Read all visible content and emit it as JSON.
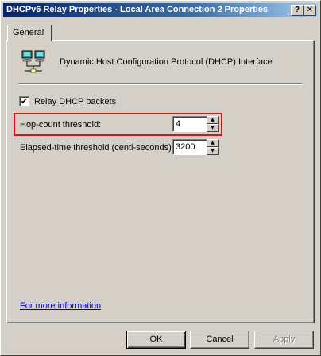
{
  "window": {
    "title": "DHCPv6 Relay Properties - Local Area Connection 2 Properties",
    "help_button": "?",
    "close_button": "✕"
  },
  "tabs": [
    {
      "label": "General",
      "selected": true
    }
  ],
  "general": {
    "icon": "network-computers-icon",
    "interface_label": "Dynamic Host Configuration Protocol (DHCP) Interface",
    "relay_checkbox": {
      "label": "Relay DHCP packets",
      "checked": true,
      "mark": "✔"
    },
    "hop_count": {
      "label": "Hop-count threshold:",
      "value": "4"
    },
    "elapsed_time": {
      "label": "Elapsed-time threshold (centi-seconds):",
      "value": "3200"
    },
    "spin_up": "▲",
    "spin_down": "▼",
    "more_info_link": "For more information"
  },
  "buttons": {
    "ok": "OK",
    "cancel": "Cancel",
    "apply": "Apply"
  },
  "colors": {
    "highlight_border": "#e01010",
    "title_bar_start": "#0a246a",
    "title_bar_end": "#a6caf0",
    "link": "#0000cc"
  }
}
